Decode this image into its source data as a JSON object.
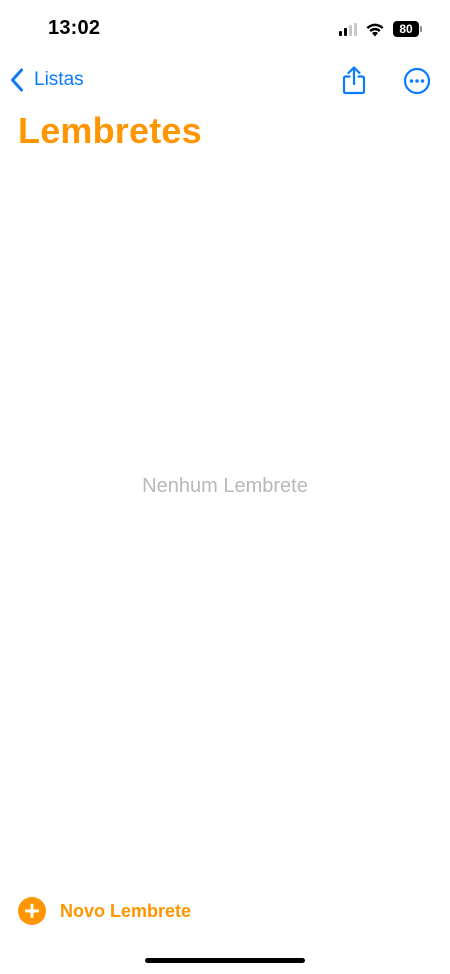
{
  "status_bar": {
    "time": "13:02",
    "battery": "80",
    "icons": [
      "signal-icon",
      "wifi-icon",
      "battery-icon"
    ]
  },
  "nav": {
    "back_label": "Listas",
    "icons": [
      "chevron-left-icon",
      "share-icon",
      "more-icon"
    ]
  },
  "title": "Lembretes",
  "empty_state": "Nenhum Lembrete",
  "toolbar": {
    "new_reminder_label": "Novo Lembrete",
    "icon": "plus-circle-icon"
  },
  "colors": {
    "accent": "#ff9500",
    "link": "#0a7aff",
    "placeholder": "#b8b8bd"
  }
}
